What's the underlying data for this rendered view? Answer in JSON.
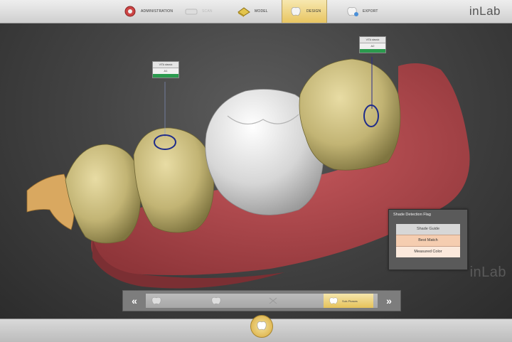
{
  "app": {
    "brand": "inLab",
    "watermark": "inLab"
  },
  "workflow_steps": [
    {
      "label": "ADMINISTRATION",
      "active": false,
      "faded": false
    },
    {
      "label": "SCAN",
      "active": false,
      "faded": true
    },
    {
      "label": "MODEL",
      "active": false,
      "faded": false
    },
    {
      "label": "DESIGN",
      "active": true,
      "faded": false
    },
    {
      "label": "EXPORT",
      "active": false,
      "faded": false
    }
  ],
  "shade_tags": [
    {
      "title": "VITA classic",
      "value": "A1",
      "color": "#2b9a4e"
    },
    {
      "title": "VITA classic",
      "value": "A2",
      "color": "#2b9a4e"
    }
  ],
  "shade_panel": {
    "title": "Shade Detection Flag",
    "items": [
      "Shade Guide",
      "Best Match",
      "Measured Color"
    ],
    "selected": "Best Match"
  },
  "bottom_nav": {
    "prev_label": "«",
    "next_label": "»",
    "active_step_label": "Sub-Phases"
  },
  "colors": {
    "accent_gold": "#e8c561",
    "tag_green": "#2b9a4e",
    "gingiva": "#b94a4d",
    "restoration": "#e6e6e6"
  }
}
